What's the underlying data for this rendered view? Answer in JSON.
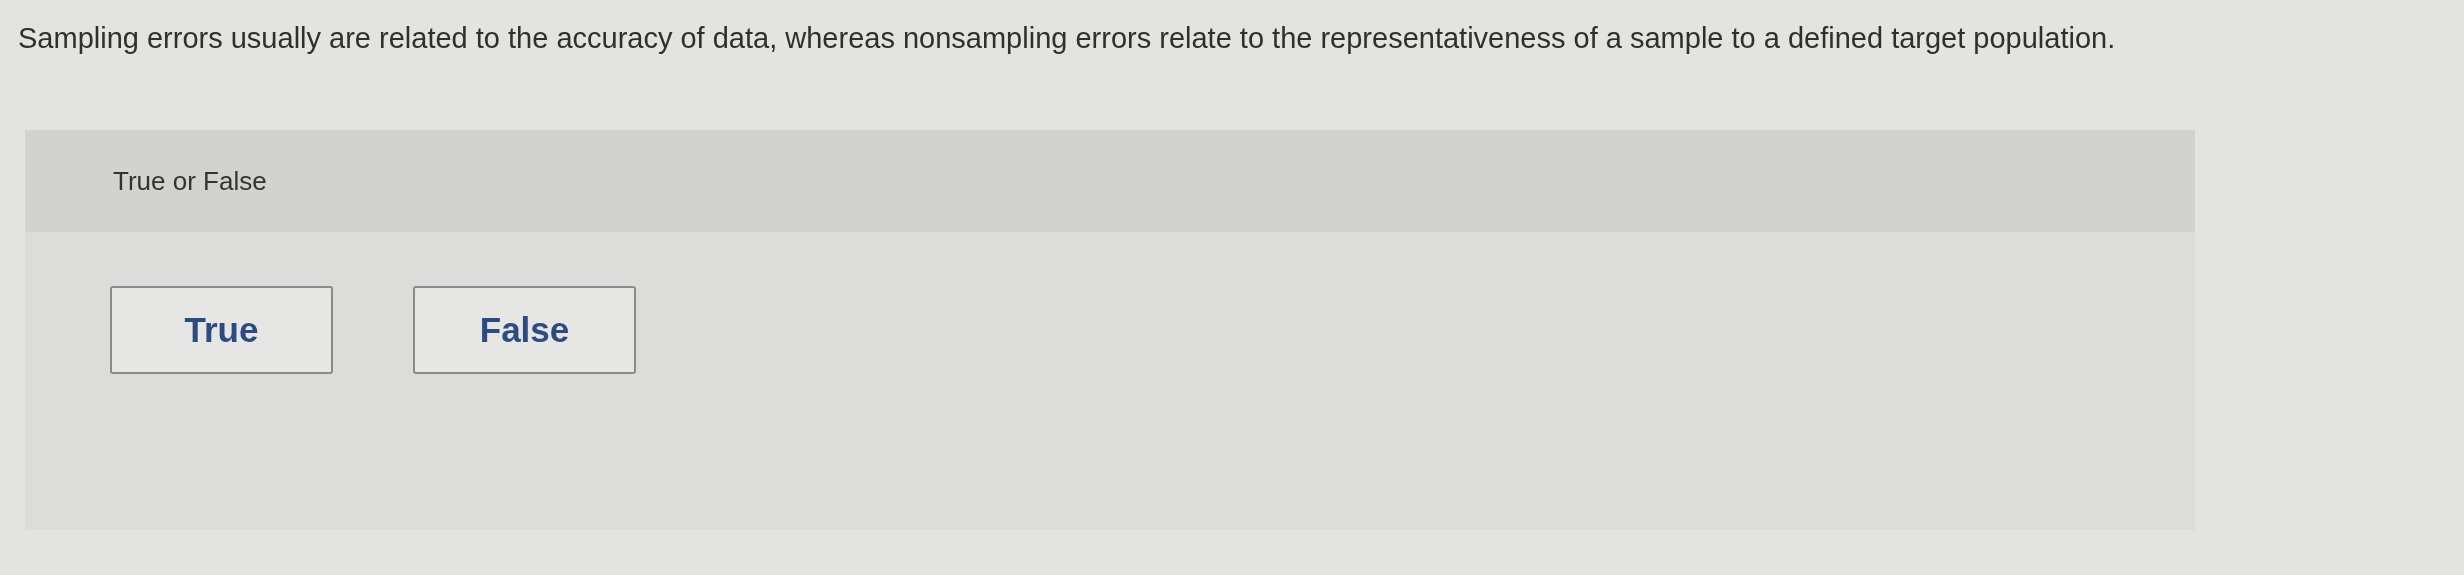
{
  "question": "Sampling errors usually are related to the accuracy of data, whereas nonsampling errors relate to the representativeness of a sample to a defined target population.",
  "answer_panel": {
    "heading": "True or False",
    "options": [
      {
        "label": "True",
        "selected": false
      },
      {
        "label": "False",
        "selected": false
      }
    ]
  }
}
